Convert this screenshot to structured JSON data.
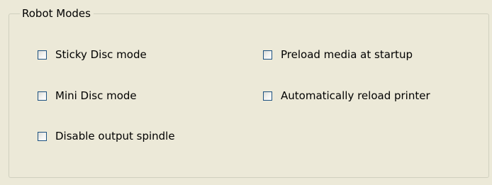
{
  "group": {
    "title": "Robot Modes"
  },
  "options": {
    "sticky_disc": {
      "label": "Sticky Disc mode",
      "checked": false
    },
    "mini_disc": {
      "label": "Mini Disc mode",
      "checked": false
    },
    "disable_output_spindle": {
      "label": "Disable output spindle",
      "checked": false
    },
    "preload_media": {
      "label": "Preload media at startup",
      "checked": false
    },
    "auto_reload_printer": {
      "label": "Automatically reload printer",
      "checked": false
    }
  }
}
